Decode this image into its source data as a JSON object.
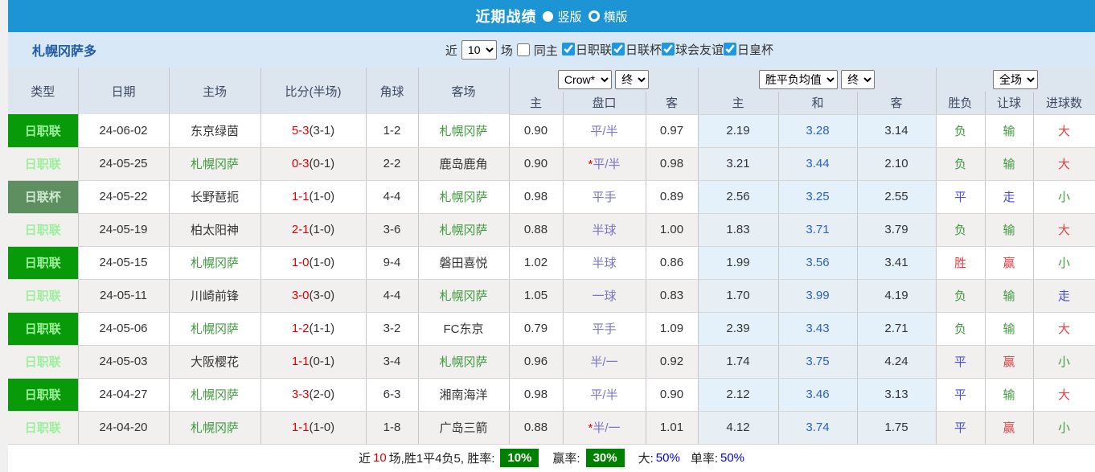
{
  "title_bar": {
    "title": "近期战绩",
    "layout_options": [
      {
        "label": "竖版",
        "selected": true
      },
      {
        "label": "横版",
        "selected": false
      }
    ]
  },
  "filter_bar": {
    "team_name": "札幌冈萨多",
    "near_label": "近",
    "matches_value": "10",
    "matches_label": "场",
    "same_home": {
      "label": "同主",
      "checked": false
    },
    "competitions": [
      {
        "label": "日职联",
        "checked": true
      },
      {
        "label": "日联杯",
        "checked": true
      },
      {
        "label": "球会友谊",
        "checked": true
      },
      {
        "label": "日皇杯",
        "checked": true
      }
    ]
  },
  "table": {
    "selects": {
      "company": "Crow*",
      "company_time": "终",
      "europe": "胜平负均值",
      "europe_time": "终",
      "scope": "全场"
    },
    "main_columns": [
      "类型",
      "日期",
      "主场",
      "比分(半场)",
      "角球",
      "客场"
    ],
    "sub_columns": [
      "主",
      "盘口",
      "客",
      "主",
      "和",
      "客",
      "胜负",
      "让球",
      "进球数"
    ],
    "rows": [
      {
        "league": "日职联",
        "league_class": "",
        "date": "24-06-02",
        "home": "东京绿茵",
        "home_focus": false,
        "score_ft": "5-3",
        "score_ht": "(3-1)",
        "corner": "1-2",
        "away": "札幌冈萨",
        "away_focus": true,
        "ah_home": "0.90",
        "ah_star": false,
        "ah_line": "平/半",
        "ah_away": "0.97",
        "odds_home": "2.19",
        "odds_draw": "3.28",
        "odds_away": "3.14",
        "result_wdl": "负",
        "result_ah": "输",
        "result_ou": "大"
      },
      {
        "league": "日职联",
        "league_class": "",
        "date": "24-05-25",
        "home": "札幌冈萨",
        "home_focus": true,
        "score_ft": "0-3",
        "score_ht": "(0-1)",
        "corner": "2-2",
        "away": "鹿岛鹿角",
        "away_focus": false,
        "ah_home": "0.90",
        "ah_star": true,
        "ah_line": "平/半",
        "ah_away": "0.98",
        "odds_home": "3.21",
        "odds_draw": "3.44",
        "odds_away": "2.10",
        "result_wdl": "负",
        "result_ah": "输",
        "result_ou": "大"
      },
      {
        "league": "日联杯",
        "league_class": "cup",
        "date": "24-05-22",
        "home": "长野琶扼",
        "home_focus": false,
        "score_ft": "1-1",
        "score_ht": "(1-0)",
        "corner": "4-4",
        "away": "札幌冈萨",
        "away_focus": true,
        "ah_home": "0.98",
        "ah_star": false,
        "ah_line": "平手",
        "ah_away": "0.89",
        "odds_home": "2.56",
        "odds_draw": "3.25",
        "odds_away": "2.55",
        "result_wdl": "平",
        "result_ah": "走",
        "result_ou": "小"
      },
      {
        "league": "日职联",
        "league_class": "",
        "date": "24-05-19",
        "home": "柏太阳神",
        "home_focus": false,
        "score_ft": "2-1",
        "score_ht": "(1-0)",
        "corner": "3-6",
        "away": "札幌冈萨",
        "away_focus": true,
        "ah_home": "0.88",
        "ah_star": false,
        "ah_line": "半球",
        "ah_away": "1.00",
        "odds_home": "1.83",
        "odds_draw": "3.71",
        "odds_away": "3.79",
        "result_wdl": "负",
        "result_ah": "输",
        "result_ou": "大"
      },
      {
        "league": "日职联",
        "league_class": "",
        "date": "24-05-15",
        "home": "札幌冈萨",
        "home_focus": true,
        "score_ft": "1-0",
        "score_ht": "(1-0)",
        "corner": "9-4",
        "away": "磐田喜悦",
        "away_focus": false,
        "ah_home": "1.02",
        "ah_star": false,
        "ah_line": "半球",
        "ah_away": "0.86",
        "odds_home": "1.99",
        "odds_draw": "3.56",
        "odds_away": "3.41",
        "result_wdl": "胜",
        "result_ah": "赢",
        "result_ou": "小"
      },
      {
        "league": "日职联",
        "league_class": "",
        "date": "24-05-11",
        "home": "川崎前锋",
        "home_focus": false,
        "score_ft": "3-0",
        "score_ht": "(3-0)",
        "corner": "4-4",
        "away": "札幌冈萨",
        "away_focus": true,
        "ah_home": "1.05",
        "ah_star": false,
        "ah_line": "一球",
        "ah_away": "0.83",
        "odds_home": "1.70",
        "odds_draw": "3.99",
        "odds_away": "4.19",
        "result_wdl": "负",
        "result_ah": "输",
        "result_ou": "走"
      },
      {
        "league": "日职联",
        "league_class": "",
        "date": "24-05-06",
        "home": "札幌冈萨",
        "home_focus": true,
        "score_ft": "1-2",
        "score_ht": "(1-1)",
        "corner": "3-2",
        "away": "FC东京",
        "away_focus": false,
        "ah_home": "0.79",
        "ah_star": false,
        "ah_line": "平手",
        "ah_away": "1.09",
        "odds_home": "2.39",
        "odds_draw": "3.43",
        "odds_away": "2.71",
        "result_wdl": "负",
        "result_ah": "输",
        "result_ou": "大"
      },
      {
        "league": "日职联",
        "league_class": "",
        "date": "24-05-03",
        "home": "大阪樱花",
        "home_focus": false,
        "score_ft": "1-1",
        "score_ht": "(0-1)",
        "corner": "3-4",
        "away": "札幌冈萨",
        "away_focus": true,
        "ah_home": "0.96",
        "ah_star": false,
        "ah_line": "半/一",
        "ah_away": "0.92",
        "odds_home": "1.74",
        "odds_draw": "3.75",
        "odds_away": "4.24",
        "result_wdl": "平",
        "result_ah": "赢",
        "result_ou": "小"
      },
      {
        "league": "日职联",
        "league_class": "",
        "date": "24-04-27",
        "home": "札幌冈萨",
        "home_focus": true,
        "score_ft": "3-3",
        "score_ht": "(2-0)",
        "corner": "6-3",
        "away": "湘南海洋",
        "away_focus": false,
        "ah_home": "0.98",
        "ah_star": false,
        "ah_line": "平/半",
        "ah_away": "0.90",
        "odds_home": "2.12",
        "odds_draw": "3.46",
        "odds_away": "3.13",
        "result_wdl": "平",
        "result_ah": "输",
        "result_ou": "大"
      },
      {
        "league": "日职联",
        "league_class": "",
        "date": "24-04-20",
        "home": "札幌冈萨",
        "home_focus": true,
        "score_ft": "1-1",
        "score_ht": "(1-0)",
        "corner": "1-8",
        "away": "广岛三箭",
        "away_focus": false,
        "ah_home": "0.88",
        "ah_star": true,
        "ah_line": "半/一",
        "ah_away": "1.01",
        "odds_home": "4.12",
        "odds_draw": "3.74",
        "odds_away": "1.75",
        "result_wdl": "平",
        "result_ah": "赢",
        "result_ou": "小"
      }
    ]
  },
  "summary": {
    "near_label": "近",
    "count": "10",
    "record_text": "场,胜1平4负5, 胜率:",
    "win_rate": "10%",
    "ah_label": "赢率:",
    "ah_rate": "30%",
    "ou_label": "大:",
    "ou_rate": "50%",
    "odd_label": "单率:",
    "odd_rate": "50%"
  },
  "colors": {
    "header_blue": "#1d95d4",
    "filter_bg": "#d9e8f6",
    "league_green": "#089a08",
    "cup_green": "#5d8f60",
    "focus_team_green": "#3e9b3e",
    "score_red": "#e30000",
    "draw_odds_blue": "#2d62c0",
    "summary_badge_green": "#008000"
  }
}
